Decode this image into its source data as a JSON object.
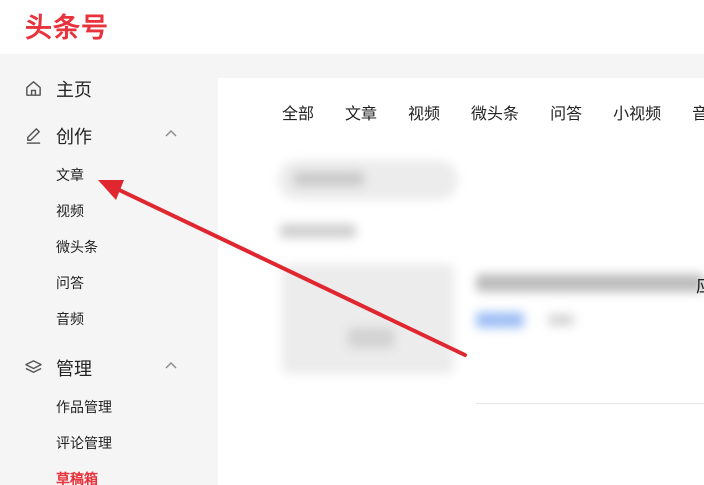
{
  "header": {
    "logo": "头条号"
  },
  "sidebar": {
    "home": {
      "label": "主页",
      "icon": "home-icon"
    },
    "create": {
      "label": "创作",
      "icon": "pen-icon",
      "items": [
        "文章",
        "视频",
        "微头条",
        "问答",
        "音频"
      ]
    },
    "manage": {
      "label": "管理",
      "icon": "layers-icon",
      "items": [
        "作品管理",
        "评论管理",
        "草稿箱"
      ]
    }
  },
  "main": {
    "tabs": [
      "全部",
      "文章",
      "视频",
      "微头条",
      "问答",
      "小视频",
      "音"
    ],
    "edge_char": "应"
  },
  "colors": {
    "brand": "#e8323c",
    "arrow": "#e0262f"
  }
}
